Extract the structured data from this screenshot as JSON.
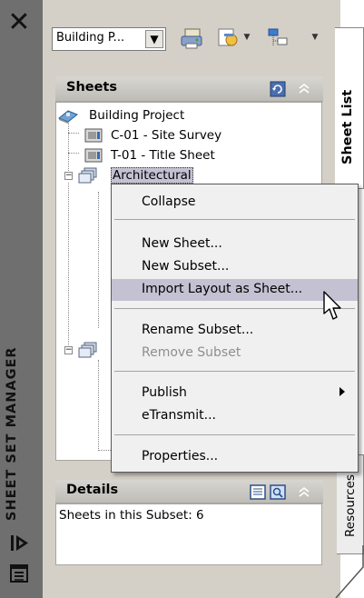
{
  "window": {
    "title": "SHEET SET MANAGER",
    "close_glyph": "✕"
  },
  "toolbar": {
    "sheet_set_combo": "Building P...",
    "combo_arrow_glyph": "▼",
    "icons": [
      "publish-icon",
      "sheet-selections-icon",
      "view-options-icon"
    ]
  },
  "sheets_panel": {
    "title": "Sheets",
    "tree": [
      {
        "label": "Building Project",
        "type": "sheet-set"
      },
      {
        "label": "C-01 - Site Survey",
        "type": "sheet"
      },
      {
        "label": "T-01 - Title Sheet",
        "type": "sheet"
      },
      {
        "label": "Architectural",
        "type": "subset",
        "expanded": true,
        "selected": true
      },
      {
        "label": "",
        "type": "subset",
        "expanded": true
      }
    ]
  },
  "context_menu": {
    "items": [
      {
        "label": "Collapse",
        "enabled": true
      },
      {
        "label": "New Sheet...",
        "enabled": true
      },
      {
        "label": "New Subset...",
        "enabled": true
      },
      {
        "label": "Import Layout as Sheet...",
        "enabled": true,
        "highlighted": true
      },
      {
        "label": "Rename Subset...",
        "enabled": true
      },
      {
        "label": "Remove Subset",
        "enabled": false
      },
      {
        "label": "Publish",
        "enabled": true,
        "submenu": true
      },
      {
        "label": "eTransmit...",
        "enabled": true
      },
      {
        "label": "Properties...",
        "enabled": true
      }
    ]
  },
  "details_panel": {
    "title": "Details",
    "text": "Sheets in this Subset: 6"
  },
  "tabs": {
    "sheet_list": "Sheet List",
    "resources": "Resources"
  },
  "colors": {
    "palette_bg": "#d4d0c8",
    "titlebar_bg": "#6f6f6f",
    "menu_highlight": "#c3c1d2"
  }
}
